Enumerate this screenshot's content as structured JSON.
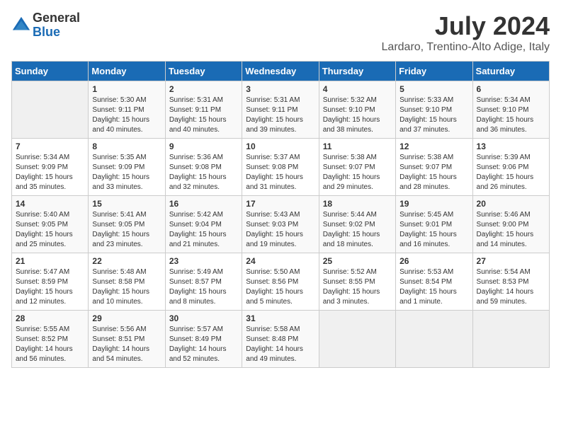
{
  "header": {
    "logo_line1": "General",
    "logo_line2": "Blue",
    "month": "July 2024",
    "location": "Lardaro, Trentino-Alto Adige, Italy"
  },
  "columns": [
    "Sunday",
    "Monday",
    "Tuesday",
    "Wednesday",
    "Thursday",
    "Friday",
    "Saturday"
  ],
  "weeks": [
    [
      {
        "day": "",
        "sunrise": "",
        "sunset": "",
        "daylight": ""
      },
      {
        "day": "1",
        "sunrise": "Sunrise: 5:30 AM",
        "sunset": "Sunset: 9:11 PM",
        "daylight": "Daylight: 15 hours and 40 minutes."
      },
      {
        "day": "2",
        "sunrise": "Sunrise: 5:31 AM",
        "sunset": "Sunset: 9:11 PM",
        "daylight": "Daylight: 15 hours and 40 minutes."
      },
      {
        "day": "3",
        "sunrise": "Sunrise: 5:31 AM",
        "sunset": "Sunset: 9:11 PM",
        "daylight": "Daylight: 15 hours and 39 minutes."
      },
      {
        "day": "4",
        "sunrise": "Sunrise: 5:32 AM",
        "sunset": "Sunset: 9:10 PM",
        "daylight": "Daylight: 15 hours and 38 minutes."
      },
      {
        "day": "5",
        "sunrise": "Sunrise: 5:33 AM",
        "sunset": "Sunset: 9:10 PM",
        "daylight": "Daylight: 15 hours and 37 minutes."
      },
      {
        "day": "6",
        "sunrise": "Sunrise: 5:34 AM",
        "sunset": "Sunset: 9:10 PM",
        "daylight": "Daylight: 15 hours and 36 minutes."
      }
    ],
    [
      {
        "day": "7",
        "sunrise": "Sunrise: 5:34 AM",
        "sunset": "Sunset: 9:09 PM",
        "daylight": "Daylight: 15 hours and 35 minutes."
      },
      {
        "day": "8",
        "sunrise": "Sunrise: 5:35 AM",
        "sunset": "Sunset: 9:09 PM",
        "daylight": "Daylight: 15 hours and 33 minutes."
      },
      {
        "day": "9",
        "sunrise": "Sunrise: 5:36 AM",
        "sunset": "Sunset: 9:08 PM",
        "daylight": "Daylight: 15 hours and 32 minutes."
      },
      {
        "day": "10",
        "sunrise": "Sunrise: 5:37 AM",
        "sunset": "Sunset: 9:08 PM",
        "daylight": "Daylight: 15 hours and 31 minutes."
      },
      {
        "day": "11",
        "sunrise": "Sunrise: 5:38 AM",
        "sunset": "Sunset: 9:07 PM",
        "daylight": "Daylight: 15 hours and 29 minutes."
      },
      {
        "day": "12",
        "sunrise": "Sunrise: 5:38 AM",
        "sunset": "Sunset: 9:07 PM",
        "daylight": "Daylight: 15 hours and 28 minutes."
      },
      {
        "day": "13",
        "sunrise": "Sunrise: 5:39 AM",
        "sunset": "Sunset: 9:06 PM",
        "daylight": "Daylight: 15 hours and 26 minutes."
      }
    ],
    [
      {
        "day": "14",
        "sunrise": "Sunrise: 5:40 AM",
        "sunset": "Sunset: 9:05 PM",
        "daylight": "Daylight: 15 hours and 25 minutes."
      },
      {
        "day": "15",
        "sunrise": "Sunrise: 5:41 AM",
        "sunset": "Sunset: 9:05 PM",
        "daylight": "Daylight: 15 hours and 23 minutes."
      },
      {
        "day": "16",
        "sunrise": "Sunrise: 5:42 AM",
        "sunset": "Sunset: 9:04 PM",
        "daylight": "Daylight: 15 hours and 21 minutes."
      },
      {
        "day": "17",
        "sunrise": "Sunrise: 5:43 AM",
        "sunset": "Sunset: 9:03 PM",
        "daylight": "Daylight: 15 hours and 19 minutes."
      },
      {
        "day": "18",
        "sunrise": "Sunrise: 5:44 AM",
        "sunset": "Sunset: 9:02 PM",
        "daylight": "Daylight: 15 hours and 18 minutes."
      },
      {
        "day": "19",
        "sunrise": "Sunrise: 5:45 AM",
        "sunset": "Sunset: 9:01 PM",
        "daylight": "Daylight: 15 hours and 16 minutes."
      },
      {
        "day": "20",
        "sunrise": "Sunrise: 5:46 AM",
        "sunset": "Sunset: 9:00 PM",
        "daylight": "Daylight: 15 hours and 14 minutes."
      }
    ],
    [
      {
        "day": "21",
        "sunrise": "Sunrise: 5:47 AM",
        "sunset": "Sunset: 8:59 PM",
        "daylight": "Daylight: 15 hours and 12 minutes."
      },
      {
        "day": "22",
        "sunrise": "Sunrise: 5:48 AM",
        "sunset": "Sunset: 8:58 PM",
        "daylight": "Daylight: 15 hours and 10 minutes."
      },
      {
        "day": "23",
        "sunrise": "Sunrise: 5:49 AM",
        "sunset": "Sunset: 8:57 PM",
        "daylight": "Daylight: 15 hours and 8 minutes."
      },
      {
        "day": "24",
        "sunrise": "Sunrise: 5:50 AM",
        "sunset": "Sunset: 8:56 PM",
        "daylight": "Daylight: 15 hours and 5 minutes."
      },
      {
        "day": "25",
        "sunrise": "Sunrise: 5:52 AM",
        "sunset": "Sunset: 8:55 PM",
        "daylight": "Daylight: 15 hours and 3 minutes."
      },
      {
        "day": "26",
        "sunrise": "Sunrise: 5:53 AM",
        "sunset": "Sunset: 8:54 PM",
        "daylight": "Daylight: 15 hours and 1 minute."
      },
      {
        "day": "27",
        "sunrise": "Sunrise: 5:54 AM",
        "sunset": "Sunset: 8:53 PM",
        "daylight": "Daylight: 14 hours and 59 minutes."
      }
    ],
    [
      {
        "day": "28",
        "sunrise": "Sunrise: 5:55 AM",
        "sunset": "Sunset: 8:52 PM",
        "daylight": "Daylight: 14 hours and 56 minutes."
      },
      {
        "day": "29",
        "sunrise": "Sunrise: 5:56 AM",
        "sunset": "Sunset: 8:51 PM",
        "daylight": "Daylight: 14 hours and 54 minutes."
      },
      {
        "day": "30",
        "sunrise": "Sunrise: 5:57 AM",
        "sunset": "Sunset: 8:49 PM",
        "daylight": "Daylight: 14 hours and 52 minutes."
      },
      {
        "day": "31",
        "sunrise": "Sunrise: 5:58 AM",
        "sunset": "Sunset: 8:48 PM",
        "daylight": "Daylight: 14 hours and 49 minutes."
      },
      {
        "day": "",
        "sunrise": "",
        "sunset": "",
        "daylight": ""
      },
      {
        "day": "",
        "sunrise": "",
        "sunset": "",
        "daylight": ""
      },
      {
        "day": "",
        "sunrise": "",
        "sunset": "",
        "daylight": ""
      }
    ]
  ]
}
